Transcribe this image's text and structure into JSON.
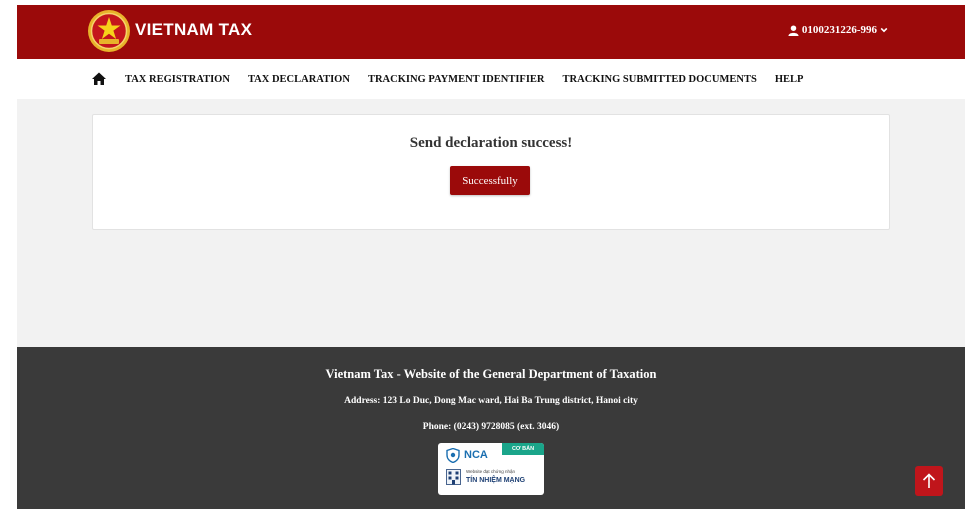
{
  "header": {
    "brand": "VIETNAM TAX",
    "account_id": "0100231226-996"
  },
  "nav": {
    "items": [
      {
        "label": "TAX REGISTRATION"
      },
      {
        "label": "TAX DECLARATION"
      },
      {
        "label": "TRACKING PAYMENT IDENTIFIER"
      },
      {
        "label": "TRACKING SUBMITTED DOCUMENTS"
      },
      {
        "label": "HELP"
      }
    ]
  },
  "main": {
    "message": "Send declaration success!",
    "button_label": "Successfully"
  },
  "footer": {
    "title": "Vietnam Tax - Website of the General Department of Taxation",
    "address": "Address: 123 Lo Duc, Dong Mac ward, Hai Ba Trung district, Hanoi city",
    "phone": "Phone: (0243) 9728085 (ext. 3046)",
    "badge": {
      "tag": "CƠ BẢN",
      "brand": "NCA",
      "small_text": "Website đạt chứng nhận",
      "main_text": "TÍN NHIỆM MẠNG"
    }
  },
  "colors": {
    "brand_red": "#9b0a0a",
    "footer_bg": "#3a3a3a",
    "to_top_red": "#c0151b",
    "badge_green": "#1aa58a"
  },
  "icons": {
    "logo": "emblem-logo",
    "account": "user-icon",
    "account_caret": "chevron-down-icon",
    "home": "home-icon",
    "back_to_top": "arrow-up-icon"
  }
}
